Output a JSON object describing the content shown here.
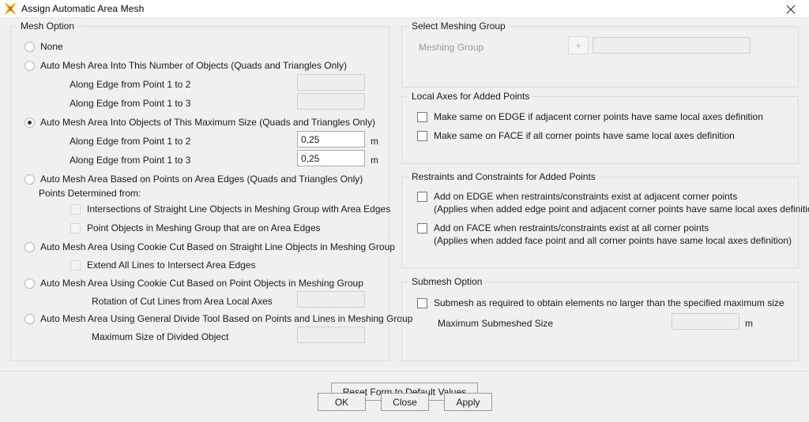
{
  "window": {
    "title": "Assign Automatic Area Mesh",
    "icon": "app-star-icon",
    "close_label": "✕"
  },
  "mesh_option": {
    "group_title": "Mesh Option",
    "options": [
      {
        "label": "None",
        "checked": false
      },
      {
        "label": "Auto Mesh Area Into This Number of Objects  (Quads and Triangles Only)",
        "checked": false
      },
      {
        "label": "Auto Mesh Area Into Objects of This Maximum Size  (Quads and Triangles Only)",
        "checked": true
      },
      {
        "label": "Auto Mesh Area Based on Points on Area Edges  (Quads and Triangles Only)",
        "checked": false
      },
      {
        "label": "Auto Mesh Area Using Cookie Cut Based on Straight Line Objects in Meshing Group",
        "checked": false
      },
      {
        "label": "Auto Mesh Area Using Cookie Cut Based on Point Objects in Meshing Group",
        "checked": false
      },
      {
        "label": "Auto Mesh Area Using General Divide Tool Based on Points and Lines in Meshing Group",
        "checked": false
      }
    ],
    "number_edge_1_2_label": "Along Edge from Point 1 to 2",
    "number_edge_1_2_value": "",
    "number_edge_1_3_label": "Along Edge from Point 1 to 3",
    "number_edge_1_3_value": "",
    "size_edge_1_2_label": "Along Edge from Point 1 to 2",
    "size_edge_1_2_value": "0,25",
    "size_edge_1_2_unit": "m",
    "size_edge_1_3_label": "Along Edge from Point 1 to 3",
    "size_edge_1_3_value": "0,25",
    "size_edge_1_3_unit": "m",
    "points_determined_label": "Points Determined from:",
    "check_intersections": "Intersections of Straight Line Objects in Meshing Group with Area Edges",
    "check_point_objects": "Point Objects in Meshing Group that are on Area Edges",
    "check_extend_lines": "Extend All Lines to Intersect Area Edges",
    "rotation_label": "Rotation of Cut Lines from Area Local Axes",
    "rotation_value": "",
    "max_divided_label": "Maximum Size of Divided Object",
    "max_divided_value": ""
  },
  "meshing_group": {
    "group_title": "Select Meshing Group",
    "label": "Meshing Group",
    "add_button": "+",
    "value": ""
  },
  "local_axes": {
    "group_title": "Local Axes for Added Points",
    "check_edge": "Make same on EDGE if adjacent corner points have same local axes definition",
    "check_face": "Make same on FACE if all corner points have same local axes definition"
  },
  "restraints": {
    "group_title": "Restraints and Constraints for Added Points",
    "check_edge": "Add on EDGE when restraints/constraints exist at adjacent corner points",
    "check_edge_note": "(Applies when added edge point and adjacent corner points have same local axes definition)",
    "check_face": "Add on FACE when restraints/constraints exist at all corner points",
    "check_face_note": "(Applies when added face point and all corner points have same local axes definition)"
  },
  "submesh": {
    "group_title": "Submesh Option",
    "check_submesh": "Submesh as required to obtain elements no larger than the specified maximum size",
    "max_size_label": "Maximum Submeshed Size",
    "max_size_value": "",
    "max_size_unit": "m"
  },
  "buttons": {
    "reset": "Reset Form to Default Values",
    "ok": "OK",
    "close": "Close",
    "apply": "Apply"
  }
}
